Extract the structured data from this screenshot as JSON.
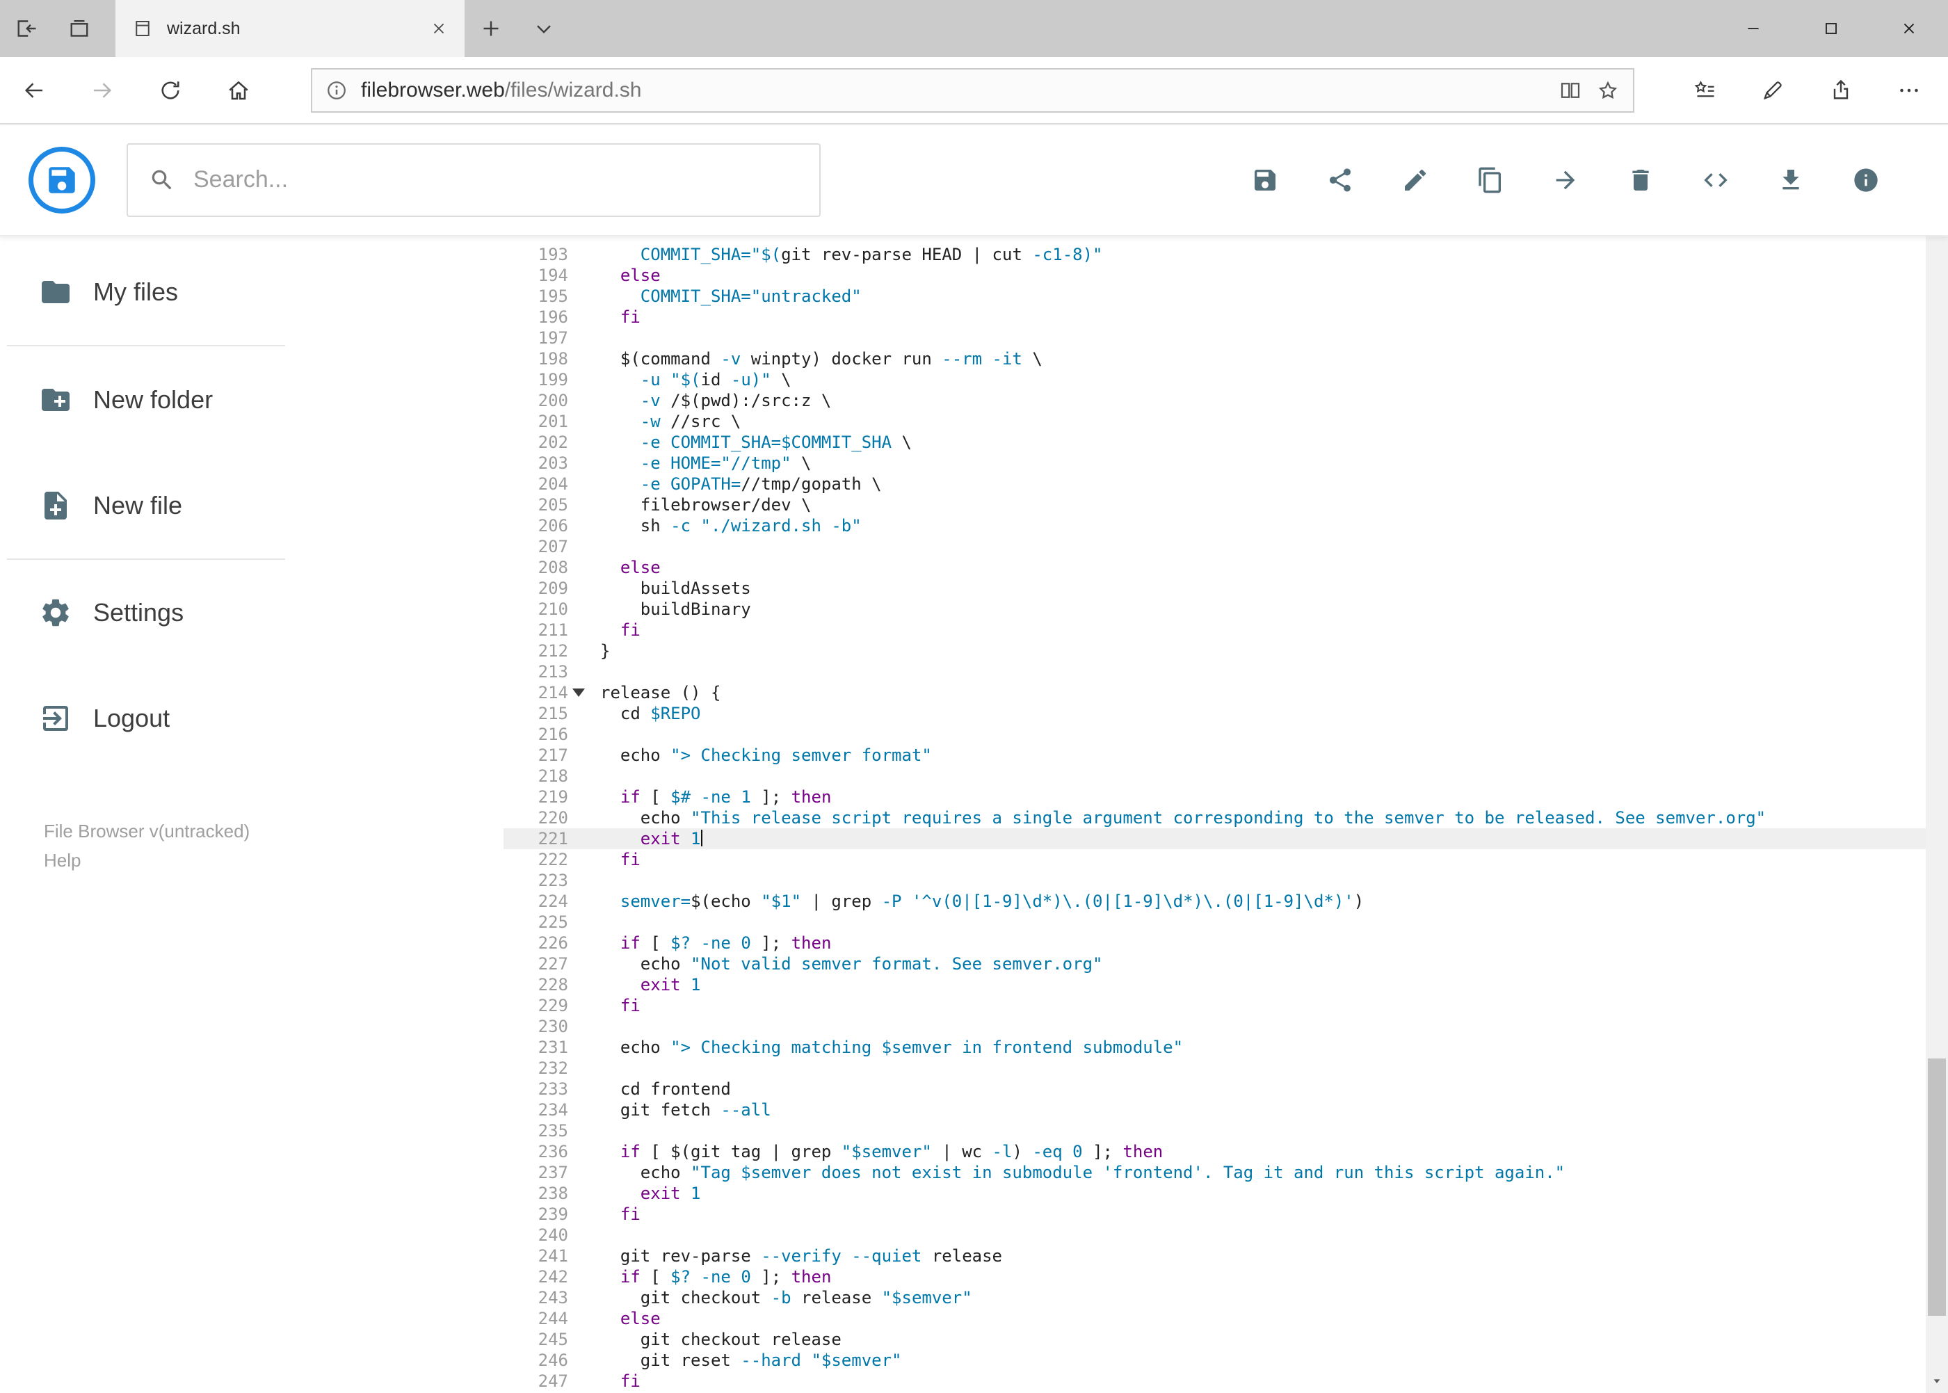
{
  "browser": {
    "tabstrip_left_icons": [
      "set-tabs-aside-icon",
      "show-set-aside-tabs-icon"
    ],
    "tab": {
      "favicon": "page-icon",
      "title": "wizard.sh",
      "close_icon": "close-icon"
    },
    "new_tab_icon": "plus-icon",
    "tab_preview_icon": "chevron-down-icon",
    "window_control_icons": [
      "minimize-icon",
      "maximize-icon",
      "close-icon"
    ],
    "nav_icons": [
      "back-icon",
      "forward-icon",
      "refresh-icon",
      "home-icon"
    ],
    "address": {
      "info_icon": "info-icon",
      "host": "filebrowser.web",
      "path": "/files/wizard.sh",
      "reading_view_icon": "reading-view-icon",
      "favorite_icon": "star-icon"
    },
    "action_icons": [
      "hub-icon",
      "web-note-icon",
      "share-page-icon",
      "more-icon"
    ]
  },
  "app": {
    "accent_color": "#1e88e5",
    "logo_icon": "floppy-logo-icon",
    "search": {
      "icon": "search-icon",
      "placeholder": "Search..."
    },
    "toolbar_icons": [
      "save-icon",
      "share-icon",
      "edit-icon",
      "copy-icon",
      "move-icon",
      "delete-icon",
      "code-icon",
      "download-icon",
      "info-circle-icon"
    ],
    "sidebar": {
      "items": [
        {
          "icon": "folder-icon",
          "label": "My files",
          "divider_after": true
        },
        {
          "icon": "new-folder-icon",
          "label": "New folder",
          "divider_after": false
        },
        {
          "icon": "new-file-icon",
          "label": "New file",
          "divider_after": true
        },
        {
          "icon": "settings-icon",
          "label": "Settings",
          "divider_after": false
        },
        {
          "icon": "logout-icon",
          "label": "Logout",
          "divider_after": false
        }
      ],
      "footer_version": "File Browser v(untracked)",
      "footer_help": "Help"
    }
  },
  "editor": {
    "syntax_colors": {
      "keyword": "#770088",
      "token": "#0077aa",
      "plain": "#222222",
      "line_number": "#9b9b9b",
      "active_line_bg": "#efefef"
    },
    "active_line": 221,
    "fold_marker_line": 214,
    "first_line": 193,
    "last_line": 247,
    "lines": [
      {
        "n": 193,
        "s": [
          [
            "p",
            "    "
          ],
          [
            "t",
            "COMMIT_SHA="
          ],
          [
            "t",
            "\"$("
          ],
          [
            "p",
            "git rev-parse HEAD | cut "
          ],
          [
            "t",
            "-c1-8"
          ],
          [
            "t",
            ")\""
          ]
        ]
      },
      {
        "n": 194,
        "s": [
          [
            "p",
            "  "
          ],
          [
            "k",
            "else"
          ]
        ]
      },
      {
        "n": 195,
        "s": [
          [
            "p",
            "    "
          ],
          [
            "t",
            "COMMIT_SHA="
          ],
          [
            "t",
            "\"untracked\""
          ]
        ]
      },
      {
        "n": 196,
        "s": [
          [
            "p",
            "  "
          ],
          [
            "k",
            "fi"
          ]
        ]
      },
      {
        "n": 197,
        "s": []
      },
      {
        "n": 198,
        "s": [
          [
            "p",
            "  $(command "
          ],
          [
            "t",
            "-v"
          ],
          [
            "p",
            " winpty) docker run "
          ],
          [
            "t",
            "--rm"
          ],
          [
            "p",
            " "
          ],
          [
            "t",
            "-it"
          ],
          [
            "p",
            " \\"
          ]
        ]
      },
      {
        "n": 199,
        "s": [
          [
            "p",
            "    "
          ],
          [
            "t",
            "-u"
          ],
          [
            "p",
            " "
          ],
          [
            "t",
            "\"$("
          ],
          [
            "p",
            "id "
          ],
          [
            "t",
            "-u"
          ],
          [
            "t",
            ")\""
          ],
          [
            "p",
            " \\"
          ]
        ]
      },
      {
        "n": 200,
        "s": [
          [
            "p",
            "    "
          ],
          [
            "t",
            "-v"
          ],
          [
            "p",
            " /$(pwd):/src:z \\"
          ]
        ]
      },
      {
        "n": 201,
        "s": [
          [
            "p",
            "    "
          ],
          [
            "t",
            "-w"
          ],
          [
            "p",
            " //src \\"
          ]
        ]
      },
      {
        "n": 202,
        "s": [
          [
            "p",
            "    "
          ],
          [
            "t",
            "-e"
          ],
          [
            "p",
            " "
          ],
          [
            "t",
            "COMMIT_SHA="
          ],
          [
            "t",
            "$COMMIT_SHA"
          ],
          [
            "p",
            " \\"
          ]
        ]
      },
      {
        "n": 203,
        "s": [
          [
            "p",
            "    "
          ],
          [
            "t",
            "-e"
          ],
          [
            "p",
            " "
          ],
          [
            "t",
            "HOME="
          ],
          [
            "t",
            "\"//tmp\""
          ],
          [
            "p",
            " \\"
          ]
        ]
      },
      {
        "n": 204,
        "s": [
          [
            "p",
            "    "
          ],
          [
            "t",
            "-e"
          ],
          [
            "p",
            " "
          ],
          [
            "t",
            "GOPATH="
          ],
          [
            "p",
            "//tmp/gopath \\"
          ]
        ]
      },
      {
        "n": 205,
        "s": [
          [
            "p",
            "    filebrowser/dev \\"
          ]
        ]
      },
      {
        "n": 206,
        "s": [
          [
            "p",
            "    sh "
          ],
          [
            "t",
            "-c"
          ],
          [
            "p",
            " "
          ],
          [
            "t",
            "\"./wizard.sh -b\""
          ]
        ]
      },
      {
        "n": 207,
        "s": []
      },
      {
        "n": 208,
        "s": [
          [
            "p",
            "  "
          ],
          [
            "k",
            "else"
          ]
        ]
      },
      {
        "n": 209,
        "s": [
          [
            "p",
            "    buildAssets"
          ]
        ]
      },
      {
        "n": 210,
        "s": [
          [
            "p",
            "    buildBinary"
          ]
        ]
      },
      {
        "n": 211,
        "s": [
          [
            "p",
            "  "
          ],
          [
            "k",
            "fi"
          ]
        ]
      },
      {
        "n": 212,
        "s": [
          [
            "p",
            "}"
          ]
        ]
      },
      {
        "n": 213,
        "s": []
      },
      {
        "n": 214,
        "s": [
          [
            "p",
            "release () {"
          ]
        ]
      },
      {
        "n": 215,
        "s": [
          [
            "p",
            "  cd "
          ],
          [
            "t",
            "$REPO"
          ]
        ]
      },
      {
        "n": 216,
        "s": []
      },
      {
        "n": 217,
        "s": [
          [
            "p",
            "  echo "
          ],
          [
            "t",
            "\"> Checking semver format\""
          ]
        ]
      },
      {
        "n": 218,
        "s": []
      },
      {
        "n": 219,
        "s": [
          [
            "p",
            "  "
          ],
          [
            "k",
            "if"
          ],
          [
            "p",
            " [ "
          ],
          [
            "t",
            "$#"
          ],
          [
            "p",
            " "
          ],
          [
            "t",
            "-ne"
          ],
          [
            "p",
            " "
          ],
          [
            "t",
            "1"
          ],
          [
            "p",
            " ]; "
          ],
          [
            "k",
            "then"
          ]
        ]
      },
      {
        "n": 220,
        "s": [
          [
            "p",
            "    echo "
          ],
          [
            "t",
            "\"This release script requires a single argument corresponding to the semver to be released. See semver.org\""
          ]
        ]
      },
      {
        "n": 221,
        "s": [
          [
            "p",
            "    "
          ],
          [
            "k",
            "exit"
          ],
          [
            "p",
            " "
          ],
          [
            "t",
            "1"
          ]
        ]
      },
      {
        "n": 222,
        "s": [
          [
            "p",
            "  "
          ],
          [
            "k",
            "fi"
          ]
        ]
      },
      {
        "n": 223,
        "s": []
      },
      {
        "n": 224,
        "s": [
          [
            "p",
            "  "
          ],
          [
            "t",
            "semver="
          ],
          [
            "p",
            "$(echo "
          ],
          [
            "t",
            "\"$1\""
          ],
          [
            "p",
            " | grep "
          ],
          [
            "t",
            "-P"
          ],
          [
            "p",
            " "
          ],
          [
            "t",
            "'^v(0|[1-9]\\d*)\\.(0|[1-9]\\d*)\\.(0|[1-9]\\d*)'"
          ],
          [
            "p",
            ")"
          ]
        ]
      },
      {
        "n": 225,
        "s": []
      },
      {
        "n": 226,
        "s": [
          [
            "p",
            "  "
          ],
          [
            "k",
            "if"
          ],
          [
            "p",
            " [ "
          ],
          [
            "t",
            "$?"
          ],
          [
            "p",
            " "
          ],
          [
            "t",
            "-ne"
          ],
          [
            "p",
            " "
          ],
          [
            "t",
            "0"
          ],
          [
            "p",
            " ]; "
          ],
          [
            "k",
            "then"
          ]
        ]
      },
      {
        "n": 227,
        "s": [
          [
            "p",
            "    echo "
          ],
          [
            "t",
            "\"Not valid semver format. See semver.org\""
          ]
        ]
      },
      {
        "n": 228,
        "s": [
          [
            "p",
            "    "
          ],
          [
            "k",
            "exit"
          ],
          [
            "p",
            " "
          ],
          [
            "t",
            "1"
          ]
        ]
      },
      {
        "n": 229,
        "s": [
          [
            "p",
            "  "
          ],
          [
            "k",
            "fi"
          ]
        ]
      },
      {
        "n": 230,
        "s": []
      },
      {
        "n": 231,
        "s": [
          [
            "p",
            "  echo "
          ],
          [
            "t",
            "\"> Checking matching $semver in frontend submodule\""
          ]
        ]
      },
      {
        "n": 232,
        "s": []
      },
      {
        "n": 233,
        "s": [
          [
            "p",
            "  cd frontend"
          ]
        ]
      },
      {
        "n": 234,
        "s": [
          [
            "p",
            "  git fetch "
          ],
          [
            "t",
            "--all"
          ]
        ]
      },
      {
        "n": 235,
        "s": []
      },
      {
        "n": 236,
        "s": [
          [
            "p",
            "  "
          ],
          [
            "k",
            "if"
          ],
          [
            "p",
            " [ $(git tag | grep "
          ],
          [
            "t",
            "\"$semver\""
          ],
          [
            "p",
            " | wc "
          ],
          [
            "t",
            "-l"
          ],
          [
            "p",
            ") "
          ],
          [
            "t",
            "-eq"
          ],
          [
            "p",
            " "
          ],
          [
            "t",
            "0"
          ],
          [
            "p",
            " ]; "
          ],
          [
            "k",
            "then"
          ]
        ]
      },
      {
        "n": 237,
        "s": [
          [
            "p",
            "    echo "
          ],
          [
            "t",
            "\"Tag $semver does not exist in submodule 'frontend'. Tag it and run this script again.\""
          ]
        ]
      },
      {
        "n": 238,
        "s": [
          [
            "p",
            "    "
          ],
          [
            "k",
            "exit"
          ],
          [
            "p",
            " "
          ],
          [
            "t",
            "1"
          ]
        ]
      },
      {
        "n": 239,
        "s": [
          [
            "p",
            "  "
          ],
          [
            "k",
            "fi"
          ]
        ]
      },
      {
        "n": 240,
        "s": []
      },
      {
        "n": 241,
        "s": [
          [
            "p",
            "  git rev-parse "
          ],
          [
            "t",
            "--verify"
          ],
          [
            "p",
            " "
          ],
          [
            "t",
            "--quiet"
          ],
          [
            "p",
            " release"
          ]
        ]
      },
      {
        "n": 242,
        "s": [
          [
            "p",
            "  "
          ],
          [
            "k",
            "if"
          ],
          [
            "p",
            " [ "
          ],
          [
            "t",
            "$?"
          ],
          [
            "p",
            " "
          ],
          [
            "t",
            "-ne"
          ],
          [
            "p",
            " "
          ],
          [
            "t",
            "0"
          ],
          [
            "p",
            " ]; "
          ],
          [
            "k",
            "then"
          ]
        ]
      },
      {
        "n": 243,
        "s": [
          [
            "p",
            "    git checkout "
          ],
          [
            "t",
            "-b"
          ],
          [
            "p",
            " release "
          ],
          [
            "t",
            "\"$semver\""
          ]
        ]
      },
      {
        "n": 244,
        "s": [
          [
            "p",
            "  "
          ],
          [
            "k",
            "else"
          ]
        ]
      },
      {
        "n": 245,
        "s": [
          [
            "p",
            "    git checkout release"
          ]
        ]
      },
      {
        "n": 246,
        "s": [
          [
            "p",
            "    git reset "
          ],
          [
            "t",
            "--hard"
          ],
          [
            "p",
            " "
          ],
          [
            "t",
            "\"$semver\""
          ]
        ]
      },
      {
        "n": 247,
        "s": [
          [
            "p",
            "  "
          ],
          [
            "k",
            "fi"
          ]
        ]
      }
    ]
  }
}
